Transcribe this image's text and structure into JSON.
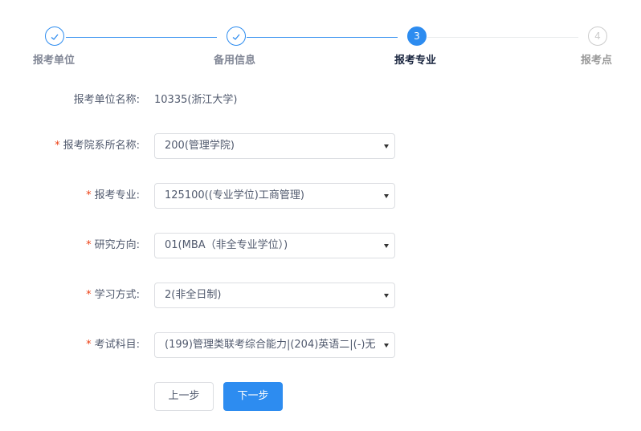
{
  "steps": [
    {
      "label": "报考单位",
      "state": "done"
    },
    {
      "label": "备用信息",
      "state": "done"
    },
    {
      "label": "报考专业",
      "state": "active",
      "number": "3"
    },
    {
      "label": "报考点",
      "state": "pending",
      "number": "4"
    }
  ],
  "form": {
    "unit": {
      "label": "报考单位名称:",
      "value": "10335(浙江大学)"
    },
    "department": {
      "label": "报考院系所名称:",
      "value": "200(管理学院)",
      "required": true
    },
    "major": {
      "label": "报考专业:",
      "value": "125100((专业学位)工商管理)",
      "required": true
    },
    "direction": {
      "label": "研究方向:",
      "value": "01(MBA（非全专业学位）)",
      "required": true
    },
    "study_mode": {
      "label": "学习方式:",
      "value": "2(非全日制)",
      "required": true
    },
    "subjects": {
      "label": "考试科目:",
      "value": "(199)管理类联考综合能力|(204)英语二|(-)无",
      "required": true
    }
  },
  "required_mark": "*",
  "buttons": {
    "prev": "上一步",
    "next": "下一步"
  },
  "colors": {
    "primary": "#2d8cf0",
    "required": "#ed4014",
    "pending": "#cccccc"
  }
}
